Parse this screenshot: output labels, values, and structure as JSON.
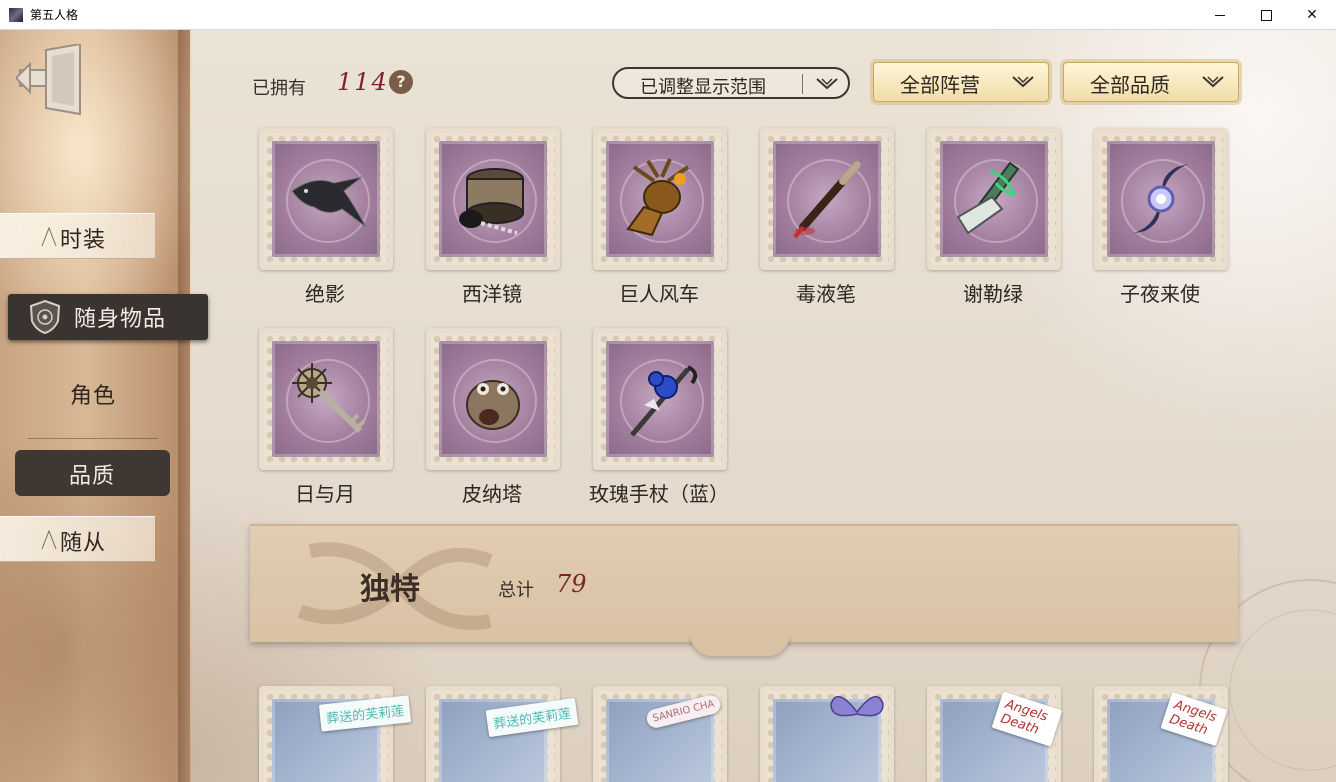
{
  "window": {
    "title": "第五人格",
    "controls": [
      "minimize",
      "maximize",
      "close"
    ]
  },
  "sidebar": {
    "items": [
      {
        "label": "时装",
        "active": false
      },
      {
        "label": "随身物品",
        "active": true
      },
      {
        "label": "角色",
        "active": false
      },
      {
        "label": "品质",
        "active": true
      },
      {
        "label": "随从",
        "active": false
      }
    ]
  },
  "header": {
    "owned_label": "已拥有",
    "owned_count": "114",
    "help_symbol": "?",
    "range_filter": "已调整显示范围",
    "faction_filter": "全部阵营",
    "quality_filter": "全部品质"
  },
  "items": [
    {
      "name": "绝影",
      "icon": "raven-icon"
    },
    {
      "name": "西洋镜",
      "icon": "zoetrope-icon"
    },
    {
      "name": "巨人风车",
      "icon": "windmill-antler-icon"
    },
    {
      "name": "毒液笔",
      "icon": "venom-pen-icon"
    },
    {
      "name": "谢勒绿",
      "icon": "green-flask-icon"
    },
    {
      "name": "子夜来使",
      "icon": "midnight-comet-icon"
    },
    {
      "name": "日与月",
      "icon": "sun-moon-key-icon"
    },
    {
      "name": "皮纳塔",
      "icon": "pinata-owl-icon"
    },
    {
      "name": "玫瑰手杖（蓝）",
      "icon": "blue-rose-cane-icon"
    }
  ],
  "quality_section": {
    "title": "独特",
    "total_label": "总计",
    "total": "79"
  },
  "next_row_tags": [
    {
      "text": "葬送的芙莉莲",
      "color": "#6fc7c3"
    },
    {
      "text": "葬送的芙莉莲",
      "color": "#6fc7c3"
    },
    {
      "text": "SANRIO CHA",
      "color": "#b06b7a"
    },
    {
      "text": "",
      "color": "#7e75c8"
    },
    {
      "text": "Angels Death",
      "color": "#b33232"
    },
    {
      "text": "Angels Death",
      "color": "#b33232"
    }
  ],
  "colors": {
    "accent_number": "#7a2424",
    "stamp_purple": "#a07d9c",
    "active_nav": "#3a3430"
  }
}
